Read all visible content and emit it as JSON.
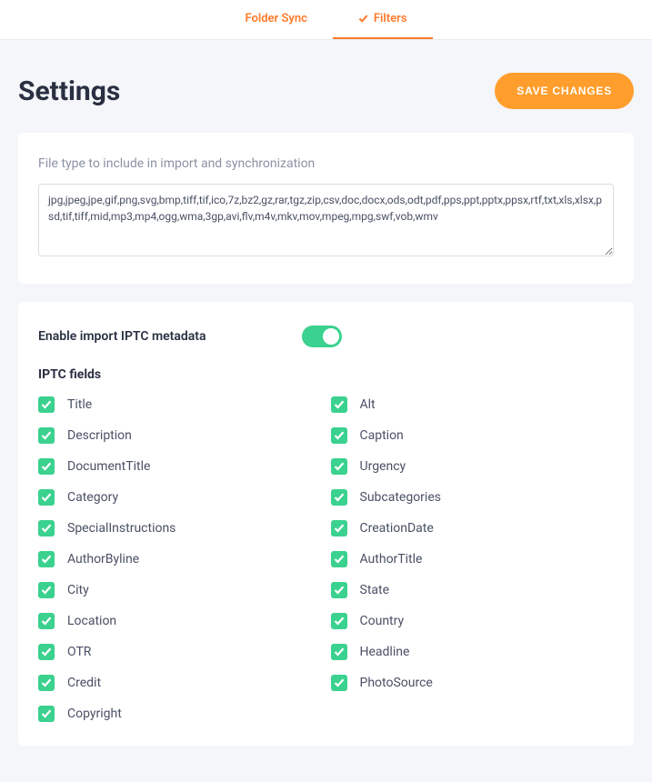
{
  "tabs": {
    "folder_sync": "Folder Sync",
    "filters": "Filters"
  },
  "page_title": "Settings",
  "save_button": "SAVE CHANGES",
  "file_types": {
    "label": "File type to include in import and synchronization",
    "value": "jpg,jpeg,jpe,gif,png,svg,bmp,tiff,tif,ico,7z,bz2,gz,rar,tgz,zip,csv,doc,docx,ods,odt,pdf,pps,ppt,pptx,ppsx,rtf,txt,xls,xlsx,psd,tif,tiff,mid,mp3,mp4,ogg,wma,3gp,avi,flv,m4v,mkv,mov,mpeg,mpg,swf,vob,wmv"
  },
  "iptc": {
    "toggle_label": "Enable import IPTC metadata",
    "toggle_on": true,
    "heading": "IPTC fields",
    "left": [
      "Title",
      "Description",
      "DocumentTitle",
      "Category",
      "SpecialInstructions",
      "AuthorByline",
      "City",
      "Location",
      "OTR",
      "Credit",
      "Copyright"
    ],
    "right": [
      "Alt",
      "Caption",
      "Urgency",
      "Subcategories",
      "CreationDate",
      "AuthorTitle",
      "State",
      "Country",
      "Headline",
      "PhotoSource"
    ]
  }
}
